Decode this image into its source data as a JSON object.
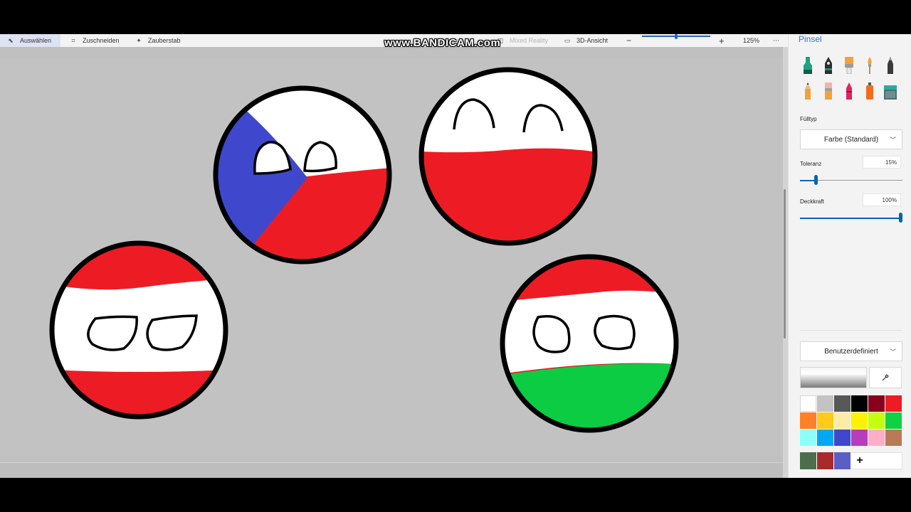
{
  "toolbar": {
    "select_label": "Auswählen",
    "crop_label": "Zuschneiden",
    "magic_label": "Zauberstab",
    "mixed_reality_label": "Mixed Reality",
    "view3d_label": "3D-Ansicht",
    "zoom_minus": "−",
    "zoom_plus": "+",
    "zoom_value": "125%",
    "more_label": "⋯"
  },
  "watermark": "www.BANDICAM.com",
  "canvas": {
    "background": "#c2c2c2",
    "balls": [
      {
        "name": "czech-ball",
        "colors": [
          "#ffffff",
          "#ed1c24",
          "#3f48cc"
        ]
      },
      {
        "name": "poland-ball",
        "colors": [
          "#ffffff",
          "#ed1c24"
        ]
      },
      {
        "name": "austria-ball",
        "colors": [
          "#ed1c24",
          "#ffffff",
          "#ed1c24"
        ]
      },
      {
        "name": "hungary-ball",
        "colors": [
          "#ed1c24",
          "#ffffff",
          "#0ccc44"
        ]
      }
    ]
  },
  "panel": {
    "title": "Pinsel",
    "brushes": [
      "marker-icon",
      "calligraphy-pen-icon",
      "oil-brush-icon",
      "watercolor-icon",
      "pixel-pen-icon",
      "pencil-icon",
      "eraser-icon",
      "crayon-icon",
      "spraycan-icon",
      "fill-bucket-icon"
    ],
    "fill_type_label": "Fülltyp",
    "fill_type_value": "Farbe (Standard)",
    "tolerance_label": "Toleranz",
    "tolerance_value": "15%",
    "tolerance_level": 0.15,
    "opacity_label": "Deckkraft",
    "opacity_value": "100%",
    "opacity_level": 1.0,
    "color_mode_value": "Benutzerdefiniert",
    "add_color_label": "+",
    "palette": [
      "#ffffff",
      "#c3c3c3",
      "#585858",
      "#000000",
      "#88001b",
      "#ed1c24",
      "#ff7f27",
      "#ffca18",
      "#fdeca6",
      "#fff200",
      "#c4ff0e",
      "#0ed145",
      "#8cfffb",
      "#00a8f3",
      "#3f48cc",
      "#b83dba",
      "#ffaec8",
      "#b97a56"
    ],
    "custom_colors": [
      "#4b6e4c",
      "#a82a2a",
      "#5a5fc4"
    ]
  }
}
